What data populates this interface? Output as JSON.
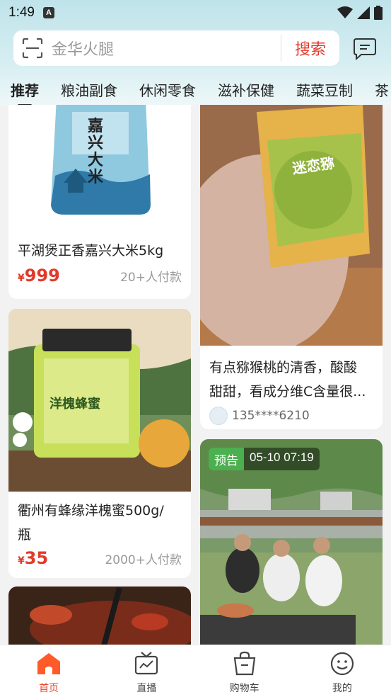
{
  "status_bar": {
    "time": "1:49",
    "app_icon_letter": "A"
  },
  "search": {
    "placeholder": "金华火腿",
    "button_label": "搜索"
  },
  "categories": [
    "推荐",
    "粮油副食",
    "休闲零食",
    "滋补保健",
    "蔬菜豆制",
    "茶"
  ],
  "feed": {
    "rice": {
      "title": "平湖煲正香嘉兴大米5kg",
      "currency": "¥",
      "price": "999",
      "sold": "20+人付款",
      "image_label": "嘉兴大米"
    },
    "kiwi": {
      "title_line1": "有点猕猴桃的清香，酸酸",
      "title_line2": "甜甜，看成分维C含量很...",
      "user": "135****6210",
      "image_label": "迷恋猕"
    },
    "honey": {
      "title_line1": "衢州有蜂缘洋槐蜜500g/",
      "title_line2": "瓶",
      "currency": "¥",
      "price": "35",
      "sold": "2000+人付款",
      "image_label": "洋槐蜂蜜"
    },
    "live": {
      "badge_tag": "预告",
      "badge_time": "05-10 07:19"
    }
  },
  "bottom_nav": [
    {
      "label": "首页",
      "icon": "home-icon",
      "active": true
    },
    {
      "label": "直播",
      "icon": "tv-icon",
      "active": false
    },
    {
      "label": "购物车",
      "icon": "cart-icon",
      "active": false
    },
    {
      "label": "我的",
      "icon": "smile-icon",
      "active": false
    }
  ],
  "colors": {
    "accent": "#e23a2a",
    "header_bg": "#bfe3ea",
    "badge_green": "#4caf50"
  }
}
